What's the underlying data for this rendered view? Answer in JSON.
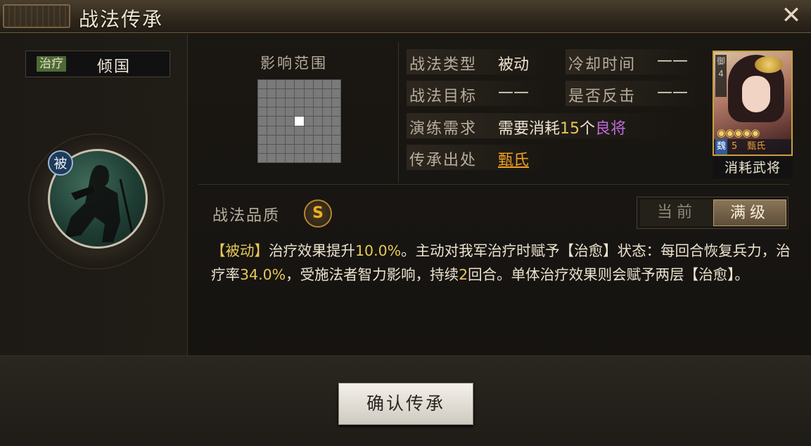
{
  "window": {
    "title": "战法传承",
    "close_glyph": "✕"
  },
  "skill": {
    "type_tag": "治疗",
    "name": "倾国",
    "passive_badge": "被",
    "icon": "soldier-silhouette-icon"
  },
  "range": {
    "title": "影响范围"
  },
  "info": {
    "skill_type_label": "战法类型",
    "skill_type_value": "被动",
    "cooldown_label": "冷却时间",
    "cooldown_value": "——",
    "target_label": "战法目标",
    "target_value": "——",
    "counter_label": "是否反击",
    "counter_value": "——",
    "practice_label": "演练需求",
    "practice_prefix": "需要消耗",
    "practice_count": "15",
    "practice_unit": "个",
    "practice_item": "良将",
    "source_label": "传承出处",
    "source_value": "甄氏"
  },
  "card": {
    "side_text": "御 4",
    "stars": "◉◉◉◉◉",
    "faction": "魏",
    "cost": "5",
    "name": "甄氏",
    "caption": "消耗武将"
  },
  "quality": {
    "label": "战法品质",
    "grade": "S"
  },
  "toggle": {
    "current_label": "当前",
    "max_label": "满级"
  },
  "description": {
    "p1": "【被动】",
    "p2": "治疗效果提升",
    "v1": "10.0%",
    "p3": "。主动对我军治疗时赋予【治愈】状态：每回合恢复兵力，治疗率",
    "v2": "34.0%",
    "p4": "，受施法者智力影响，持续",
    "v3": "2",
    "p5": "回合。单体治疗效果则会赋予两层【治愈】。"
  },
  "actions": {
    "confirm_label": "确认传承"
  },
  "colors": {
    "highlight": "#e6c85a",
    "purple": "#c06ad8",
    "orange": "#f0a020"
  }
}
